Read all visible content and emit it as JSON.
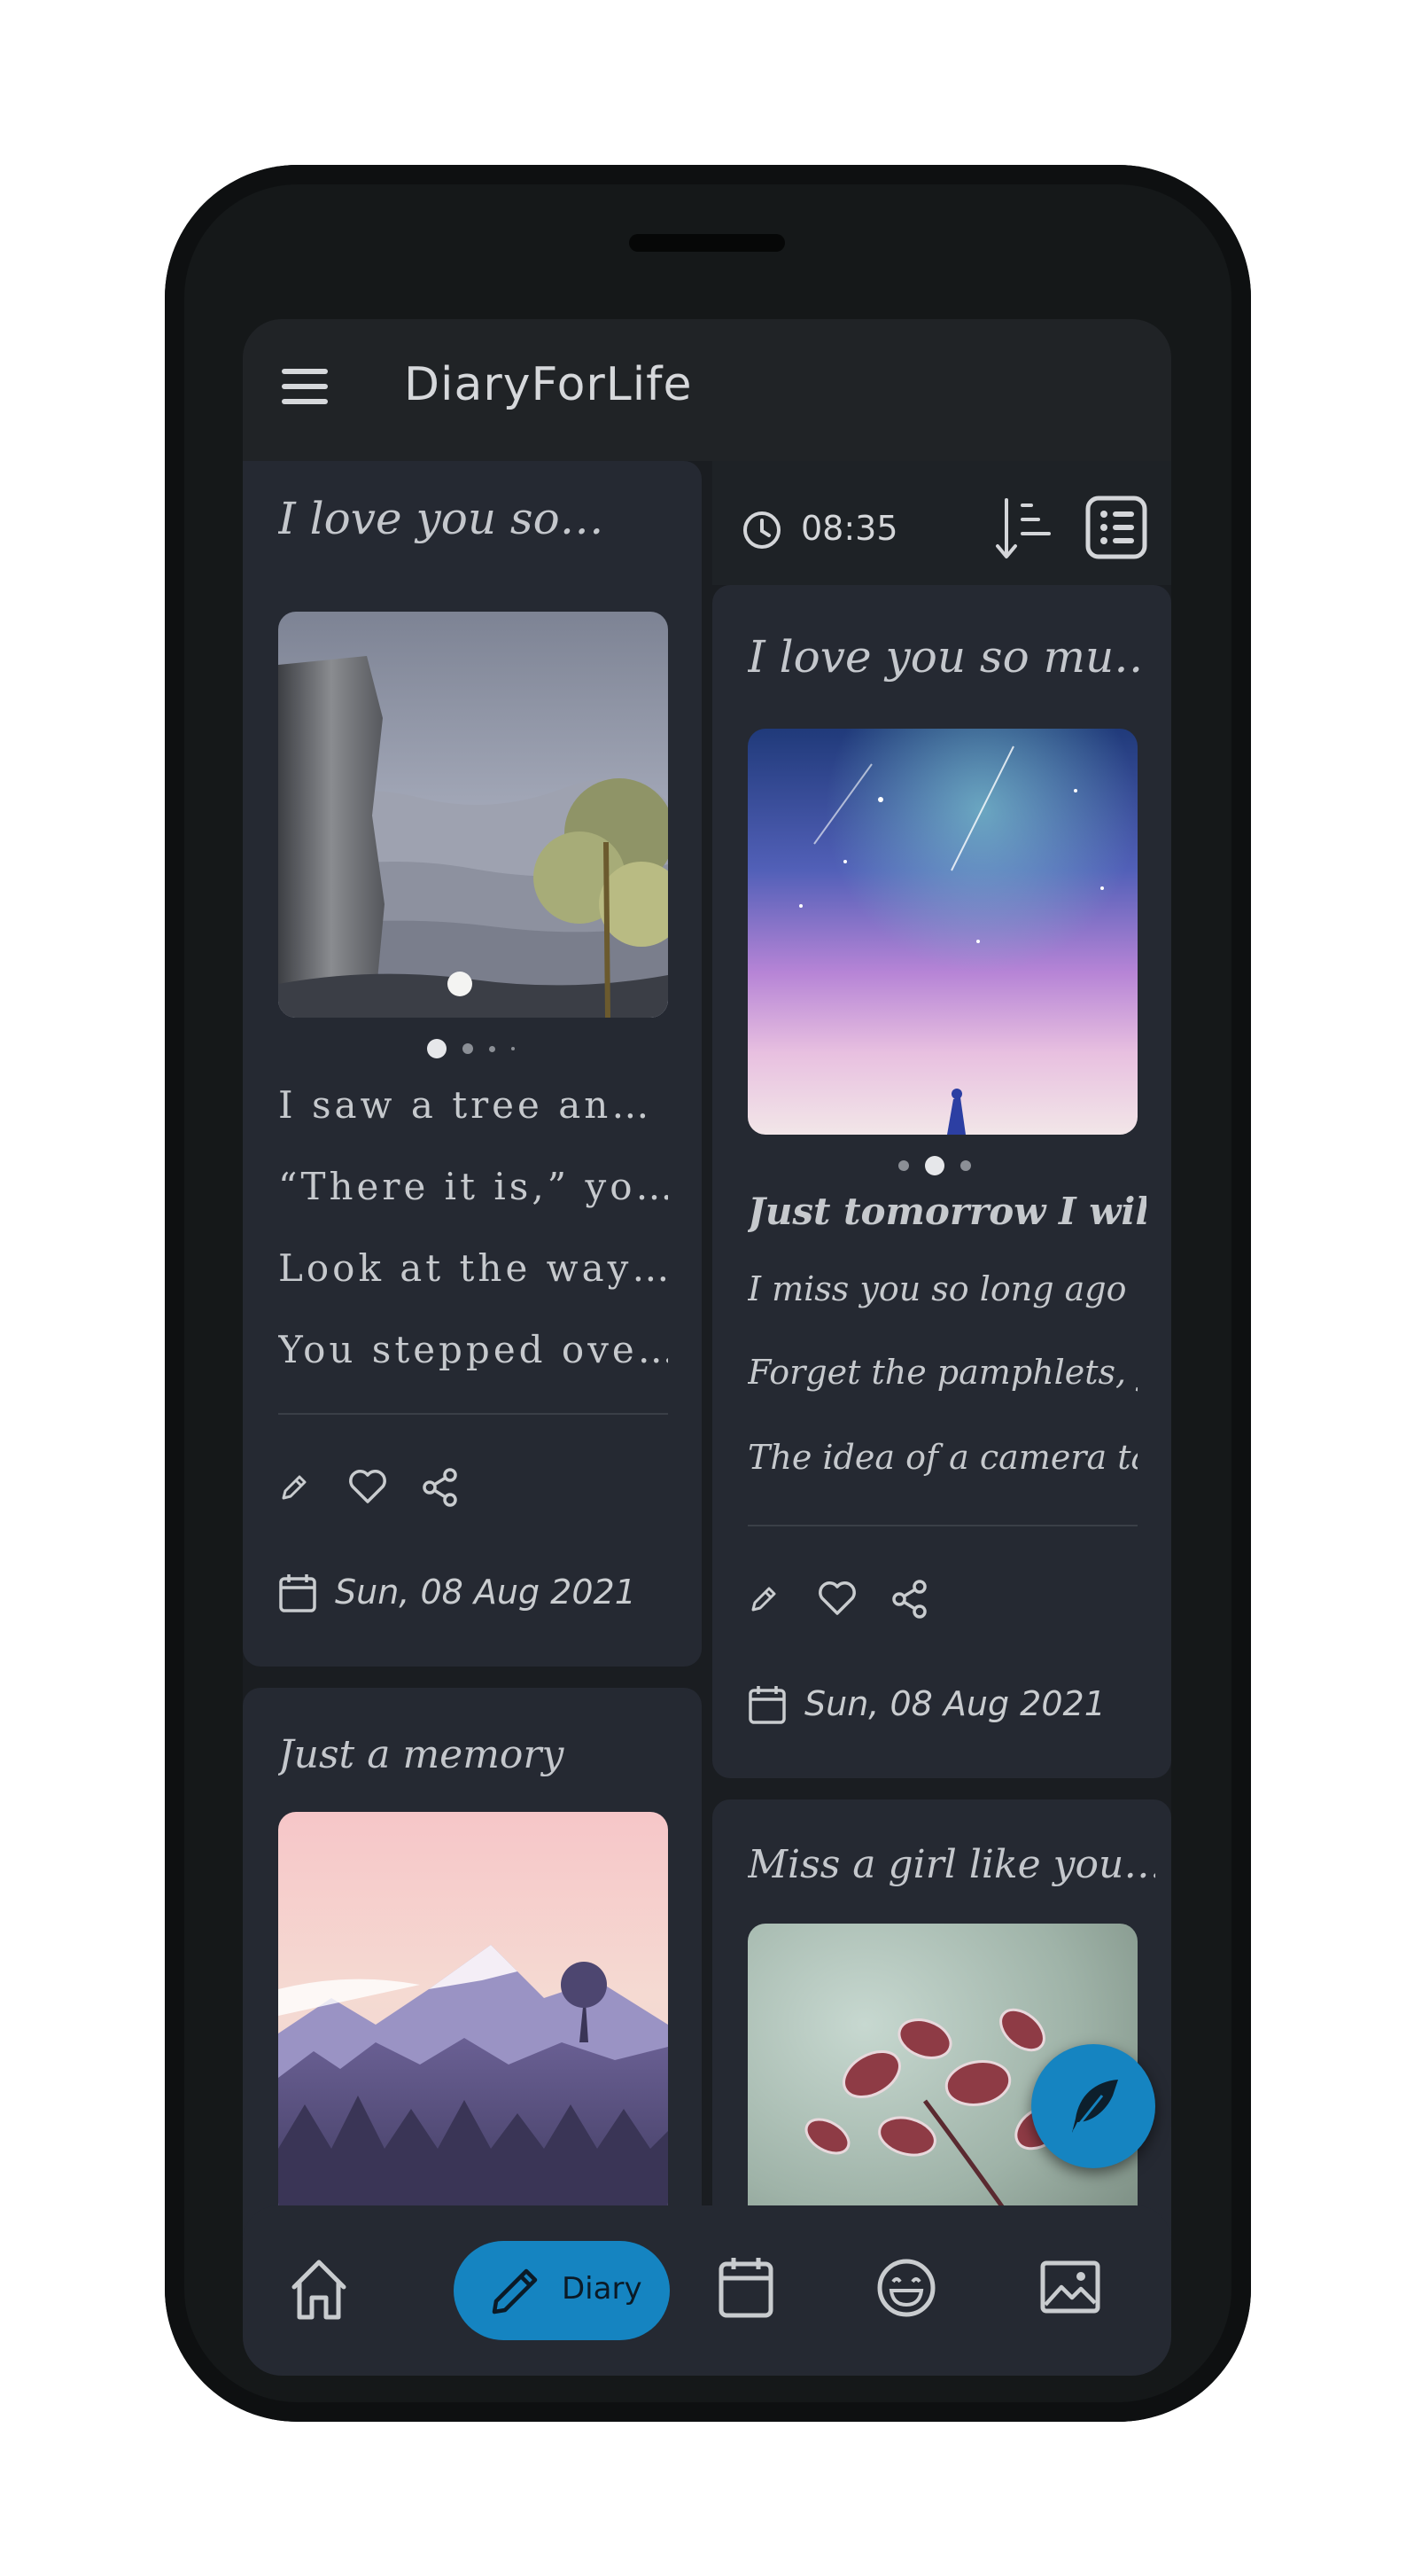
{
  "app": {
    "title": "DiaryForLife"
  },
  "toolbar": {
    "time": "08:35"
  },
  "cards": {
    "left_top": {
      "title": "I love you so…",
      "lines": [
        "I saw a tree an…",
        "“There it is,” yo…",
        "Look at the way…",
        "You stepped ove…"
      ],
      "date": "Sun, 08 Aug 2021",
      "carousel": {
        "count": 4,
        "active": 0
      }
    },
    "right_top": {
      "title": "I love you so mu…",
      "lines": [
        "Just tomorrow I will go…",
        "I miss you so long ago …",
        "Forget the pamphlets, yo…",
        "The idea of a camera ta…"
      ],
      "date": "Sun, 08 Aug 2021",
      "carousel": {
        "count": 3,
        "active": 1
      }
    },
    "left_bottom": {
      "title": "Just a memory"
    },
    "right_bottom": {
      "title": "Miss a girl like you… ···"
    }
  },
  "bottom_nav": {
    "items": [
      {
        "icon": "home-icon"
      },
      {
        "icon": "pencil-icon",
        "label": "Diary",
        "active": true
      },
      {
        "icon": "calendar-icon"
      },
      {
        "icon": "smiley-icon"
      },
      {
        "icon": "image-icon"
      }
    ]
  },
  "colors": {
    "accent": "#1584c1",
    "background": "#1a1d21",
    "card": "#252932",
    "text": "#c6c9cd"
  }
}
